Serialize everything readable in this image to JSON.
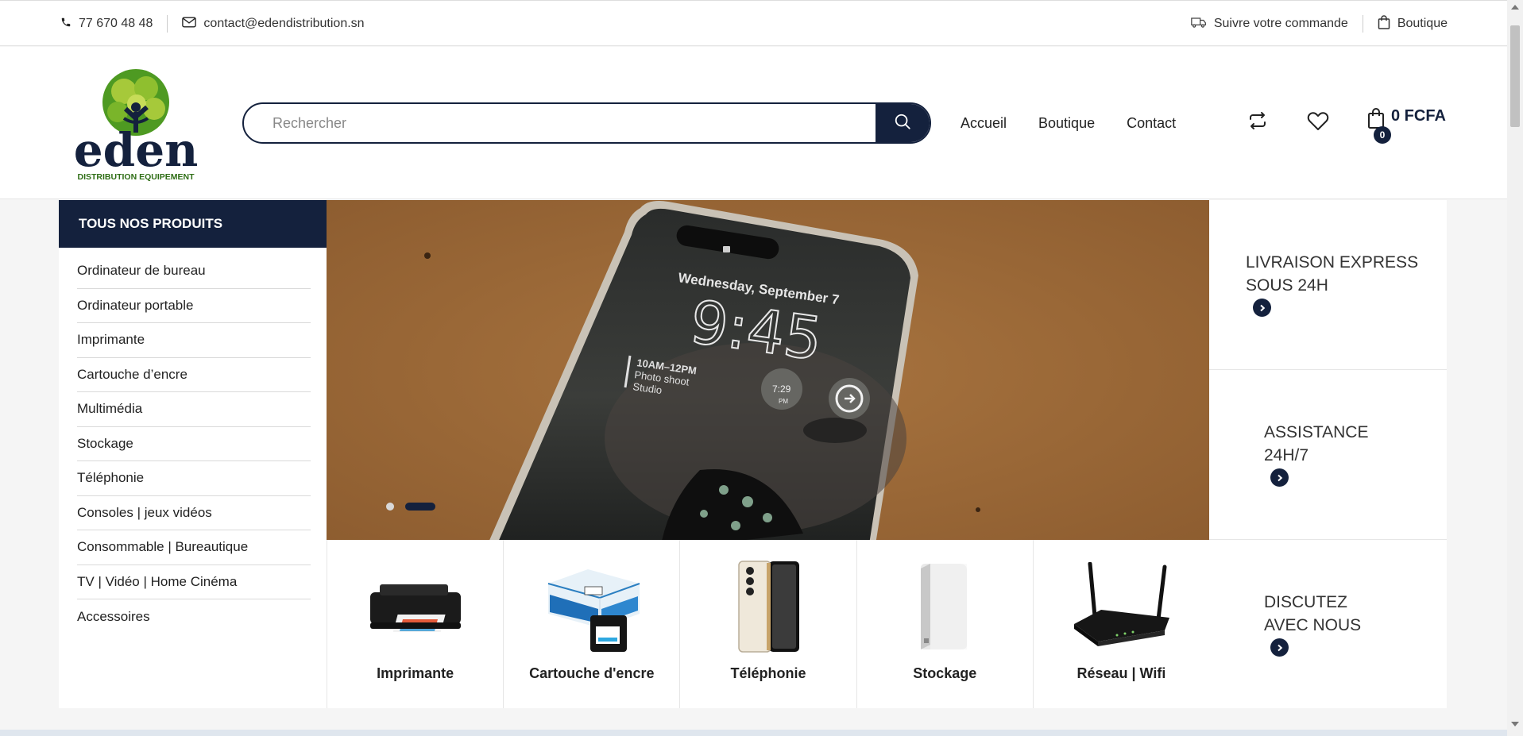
{
  "topbar": {
    "phone": "77 670 48 48",
    "email": "contact@edendistribution.sn",
    "track_order": "Suivre votre commande",
    "shop": "Boutique"
  },
  "logo": {
    "brand": "eden",
    "tagline": "DISTRIBUTION EQUIPEMENT"
  },
  "search": {
    "placeholder": "Rechercher"
  },
  "nav": {
    "items": [
      "Accueil",
      "Boutique",
      "Contact"
    ]
  },
  "cart": {
    "count": "0",
    "total": "0 FCFA"
  },
  "sidebar": {
    "title": "TOUS NOS PRODUITS",
    "items": [
      "Ordinateur de bureau",
      "Ordinateur portable",
      "Imprimante",
      "Cartouche d’encre",
      "Multimédia",
      "Stockage",
      "Téléphonie",
      "Consoles | jeux vidéos",
      "Consommable | Bureautique",
      "TV | Vidéo | Home Cinéma",
      "Accessoires"
    ]
  },
  "hero": {
    "phone_date": "Wednesday, September 7",
    "phone_time": "9:45",
    "phone_event": [
      "10AM–12PM",
      "Photo shoot",
      "Studio"
    ],
    "phone_widget": "7:29",
    "phone_widget_sub": "PM",
    "slides": 2,
    "active_slide": 2
  },
  "services": [
    {
      "line1": "LIVRAISON EXPRESS",
      "line2": "SOUS 24H"
    },
    {
      "line1": "ASSISTANCE",
      "line2": "24H/7"
    },
    {
      "line1": "DISCUTEZ",
      "line2": "AVEC NOUS"
    }
  ],
  "categories": [
    {
      "name": "Imprimante",
      "icon": "printer-image"
    },
    {
      "name": "Cartouche d'encre",
      "icon": "ink-cartridge-image"
    },
    {
      "name": "Téléphonie",
      "icon": "smartphone-image"
    },
    {
      "name": "Stockage",
      "icon": "storage-drive-image"
    },
    {
      "name": "Réseau | Wifi",
      "icon": "wifi-router-image"
    }
  ],
  "colors": {
    "primary": "#14213d",
    "logo_green": "#3f8f1f",
    "logo_lime": "#a6c93a"
  }
}
